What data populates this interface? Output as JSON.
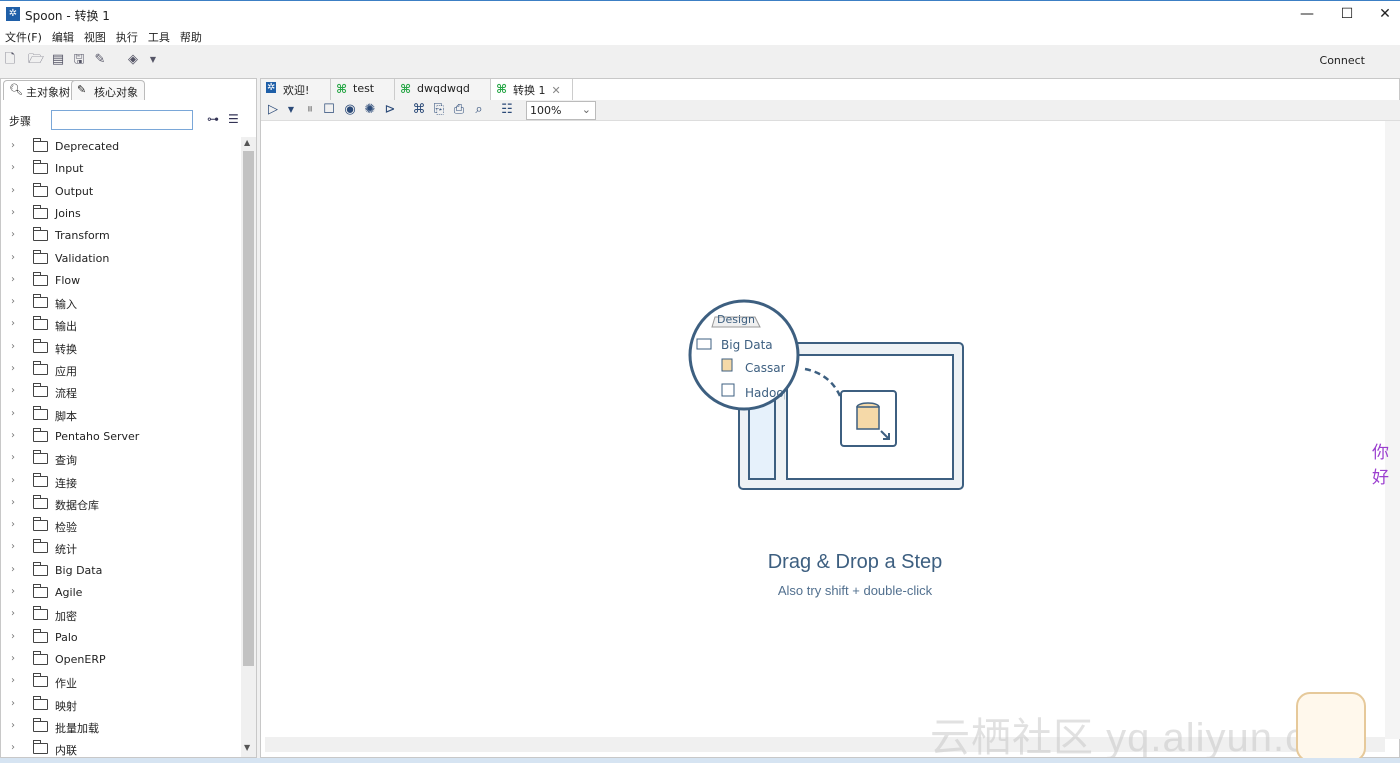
{
  "window": {
    "title": "Spoon - 转换 1",
    "minimize": "—",
    "maximize": "☐",
    "close": "✕"
  },
  "menu": [
    "文件(F)",
    "编辑",
    "视图",
    "执行",
    "工具",
    "帮助"
  ],
  "toolbar": {
    "connect": "Connect"
  },
  "left": {
    "tabs": [
      "主对象树",
      "核心对象"
    ],
    "search_label": "步骤",
    "search_value": "",
    "tree": [
      "Deprecated",
      "Input",
      "Output",
      "Joins",
      "Transform",
      "Validation",
      "Flow",
      "输入",
      "输出",
      "转换",
      "应用",
      "流程",
      "脚本",
      "Pentaho Server",
      "查询",
      "连接",
      "数据仓库",
      "检验",
      "统计",
      "Big Data",
      "Agile",
      "加密",
      "Palo",
      "OpenERP",
      "作业",
      "映射",
      "批量加载",
      "内联"
    ]
  },
  "editor": {
    "tabs": [
      "欢迎!",
      "test",
      "dwqdwqd",
      "转换 1"
    ],
    "zoom": "100%",
    "illustration": {
      "tab": "Design",
      "folder": "Big Data",
      "items": [
        "Cassandr",
        "Hadoop"
      ]
    },
    "drag_title": "Drag & Drop a Step",
    "drag_subtitle": "Also try shift + double-click"
  },
  "overlay": {
    "watermark": "云栖社区 yq.aliyun.com",
    "side_text": "你好"
  },
  "colors": {
    "accent": "#1f5fa8",
    "illustration": "#3d5f80",
    "tab_icon": "#2ba84a"
  }
}
